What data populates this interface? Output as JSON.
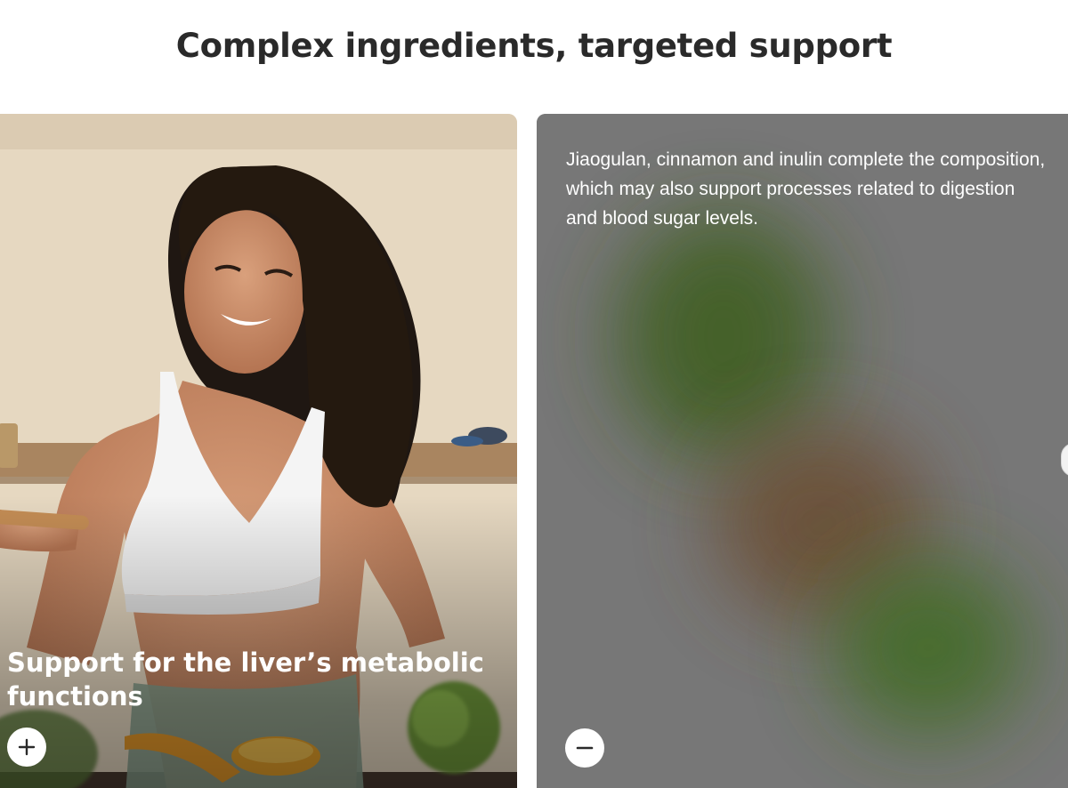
{
  "section": {
    "title": "Complex ingredients, targeted support"
  },
  "cards": [
    {
      "heading": "Support for the liver’s metabolic functions",
      "toggle_icon": "plus-icon",
      "expanded": false
    },
    {
      "body": "Jiaogulan, cinnamon and inulin complete the composition, which may also support processes related to digestion and blood sugar levels.",
      "toggle_icon": "minus-icon",
      "expanded": true
    }
  ],
  "carousel": {
    "next_icon": "chevron-right-icon"
  },
  "colors": {
    "title_text": "#2a2a2a",
    "card_text_bg": "#787878",
    "card_text_fg": "#ffffff",
    "toggle_bg": "#ffffff",
    "toggle_icon": "#2a2a2a"
  }
}
